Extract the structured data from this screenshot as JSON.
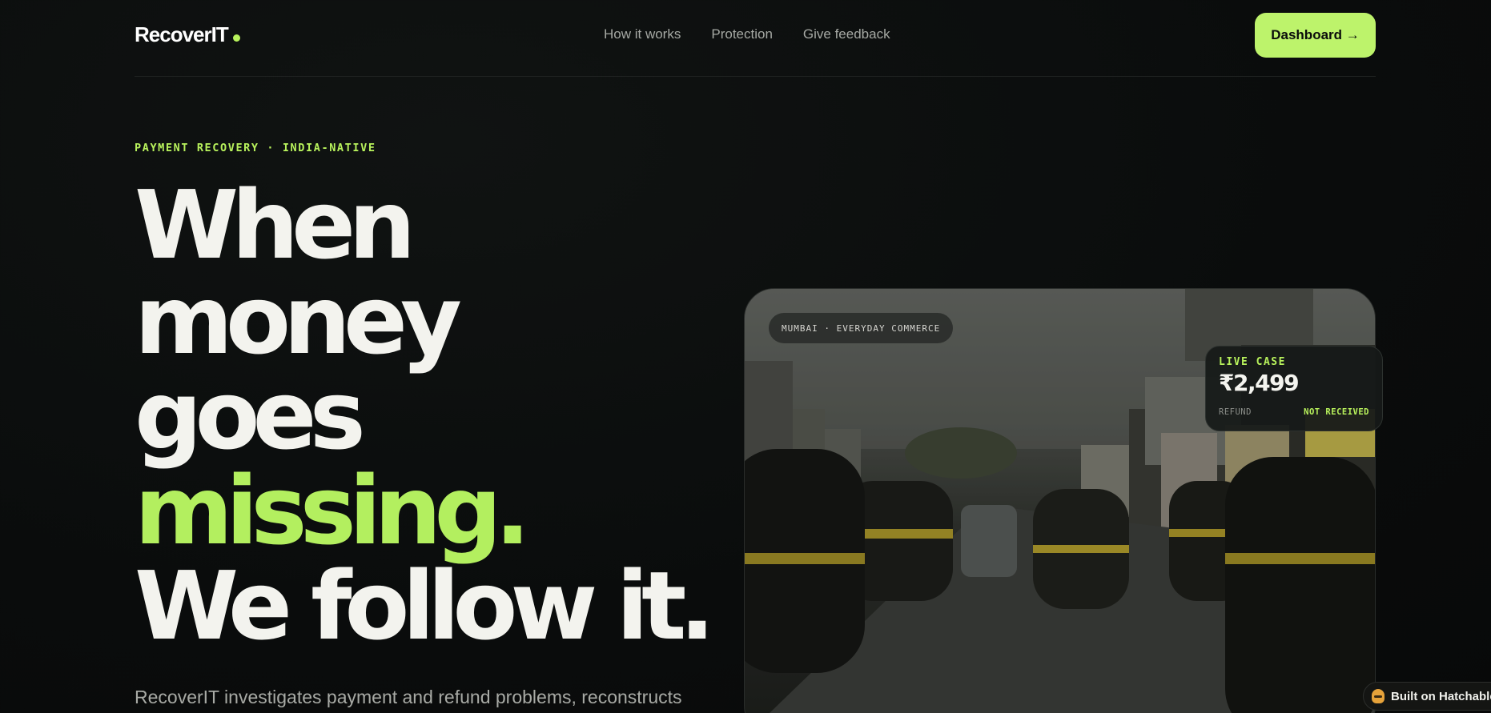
{
  "brand": {
    "name": "RecoverIT",
    "accent": "#b8f25c"
  },
  "nav": {
    "links": [
      "How it works",
      "Protection",
      "Give feedback"
    ],
    "cta": "Dashboard →"
  },
  "hero": {
    "eyebrow": "PAYMENT RECOVERY · INDIA-NATIVE",
    "headline": [
      "When",
      "money",
      "goes",
      "missing.",
      "We follow it."
    ],
    "lead": "RecoverIT investigates payment and refund problems, reconstructs"
  },
  "image_card": {
    "location": "MUMBAI · EVERYDAY COMMERCE",
    "scene": "Mumbai street with auto-rickshaws"
  },
  "live_case": {
    "label": "LIVE CASE",
    "amount": "₹2,499",
    "type": "REFUND",
    "status": "NOT RECEIVED"
  },
  "badge": {
    "text": "Built on Hatchable"
  },
  "colors": {
    "background": "#0a0c0c",
    "accent": "#b8f25c",
    "button": "#bdf36b"
  }
}
